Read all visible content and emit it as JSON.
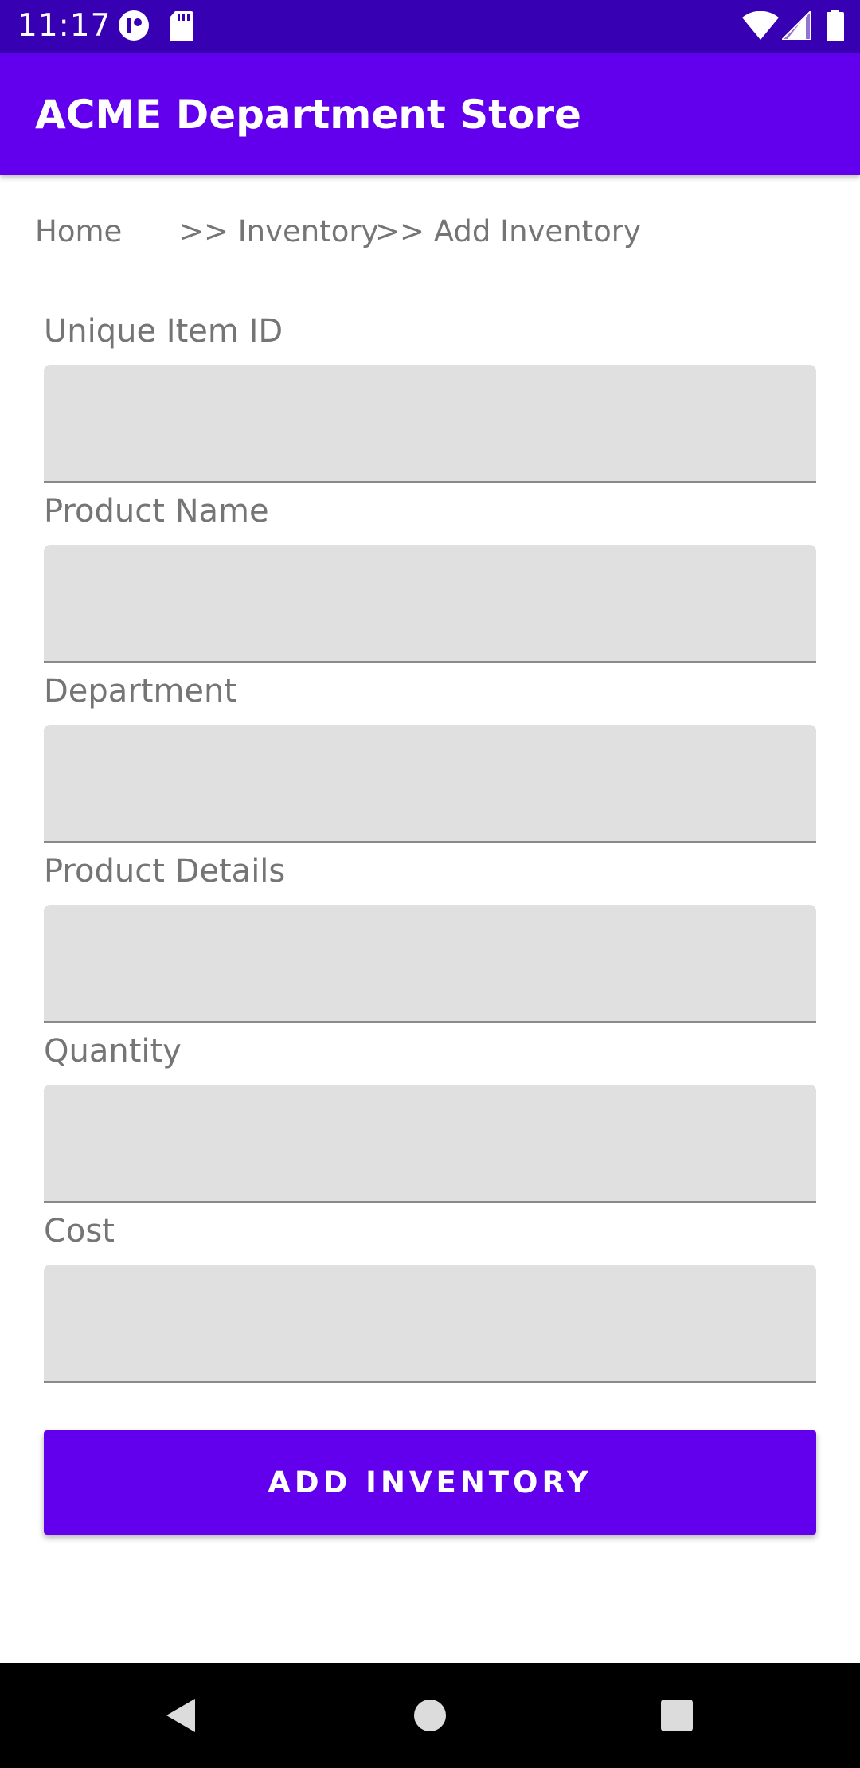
{
  "status_bar": {
    "time": "11:17"
  },
  "app_bar": {
    "title": "ACME Department Store"
  },
  "breadcrumb": {
    "home": "Home",
    "inventory": ">> Inventory",
    "add_inventory": ">> Add Inventory"
  },
  "form": {
    "fields": [
      {
        "label": "Unique Item ID",
        "value": ""
      },
      {
        "label": "Product Name",
        "value": ""
      },
      {
        "label": "Department",
        "value": ""
      },
      {
        "label": "Product Details",
        "value": ""
      },
      {
        "label": "Quantity",
        "value": ""
      },
      {
        "label": "Cost",
        "value": ""
      }
    ],
    "submit_label": "ADD INVENTORY"
  },
  "colors": {
    "status_bar": "#3700b3",
    "primary": "#6200ee",
    "input_bg": "#e0e0e0",
    "label_text": "#757575"
  },
  "icons": {
    "status_left": [
      "notification-app-icon",
      "sd-card-icon"
    ],
    "status_right": [
      "wifi-icon",
      "cellular-signal-icon",
      "battery-icon"
    ],
    "nav": [
      "back-icon",
      "home-icon",
      "recents-icon"
    ]
  }
}
